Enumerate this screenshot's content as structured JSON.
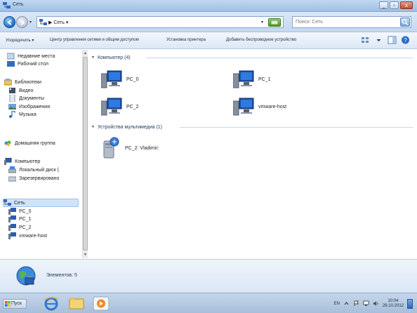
{
  "window": {
    "title": "Сеть",
    "minimize": "_",
    "restore": "▫",
    "close": "x"
  },
  "address": {
    "crumb_root": "▶",
    "crumb": "Сеть",
    "crumb_chevron": "▾",
    "dropdown": "▾",
    "search_placeholder": "Поиск: Сеть"
  },
  "toolbar": {
    "organize": "Упорядочить ▾",
    "network_center": "Центр управления сетями и общим доступом",
    "add_printer": "Установка принтера",
    "add_wireless": "Добавить беспроводное устройство"
  },
  "nav": {
    "recent": "Недавние места",
    "desktop": "Рабочий стол",
    "libraries": "Библиотеки",
    "video": "Видео",
    "documents": "Документы",
    "images": "Изображения",
    "music": "Музыка",
    "homegroup": "Домашняя группа",
    "computer": "Компьютер",
    "local_disk": "Локальный диск (",
    "reserved": "Зарезервировано",
    "network": "Сеть",
    "network_items": [
      "PC_0",
      "PC_1",
      "PC_2",
      "vmware-host"
    ]
  },
  "content": {
    "group_computers": "Компьютер (4)",
    "computers": [
      "PC_0",
      "PC_1",
      "PC_2",
      "vmware-host"
    ],
    "group_media": "Устройства мультимедиа (1)",
    "media": [
      "PC_2: Vladimir:"
    ]
  },
  "details": {
    "count": "Элементов: 5"
  },
  "taskbar": {
    "start": "Пуск",
    "lang": "EN",
    "time": "10:04",
    "date": "29.10.2012"
  },
  "colors": {
    "accent": "#1c6fc6",
    "selection": "#cfe3f9",
    "title_gradient_top": "#c0d8f0"
  }
}
